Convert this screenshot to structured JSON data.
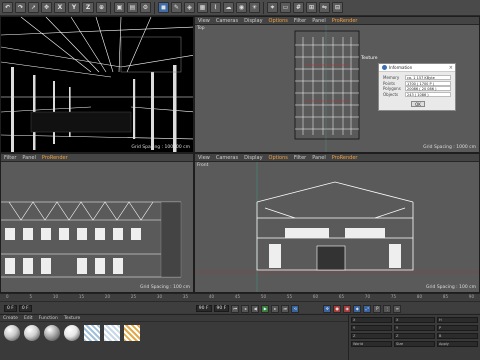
{
  "toolbar": {
    "axis_x": "X",
    "axis_y": "Y",
    "axis_z": "Z"
  },
  "viewport_menu": [
    "View",
    "Cameras",
    "Display",
    "Options",
    "Filter",
    "Panel",
    "ProRender"
  ],
  "perspective_menu": [
    "Filter",
    "Panel",
    "ProRender"
  ],
  "viewports": {
    "top": {
      "title": "Top",
      "grid": "Grid Spacing : 1000 cm"
    },
    "perspective": {
      "title": "",
      "grid": "Grid Spacing : 100000 cm"
    },
    "right": {
      "title": "",
      "grid": "Grid Spacing : 100 cm"
    },
    "front": {
      "title": "Front",
      "grid": "Grid Spacing : 100 cm"
    }
  },
  "texture_label": "Texture",
  "info_dialog": {
    "title": "Information",
    "rows": [
      {
        "key": "Memory",
        "value": "ca. 1 157 KByte"
      },
      {
        "key": "Points",
        "value": "1700 ( 1700 P )"
      },
      {
        "key": "Polygons",
        "value": "20086 ( 20 086 )"
      },
      {
        "key": "Objects",
        "value": "243 ( 1086 )"
      }
    ],
    "ok_label": "OK"
  },
  "timeline": {
    "ticks": [
      "0",
      "5",
      "10",
      "15",
      "20",
      "25",
      "30",
      "35",
      "40",
      "45",
      "50",
      "55",
      "60",
      "65",
      "70",
      "75",
      "80",
      "85",
      "90"
    ],
    "current_frame": "0 F",
    "start_frame": "0 F",
    "end_frame": "90 F",
    "frame_field": "90 F"
  },
  "materials": {
    "menu": [
      "Create",
      "Edit",
      "Function",
      "Texture"
    ],
    "items": [
      {
        "label": "",
        "kind": "ball",
        "color": "#c8c8c8"
      },
      {
        "label": "",
        "kind": "ball",
        "color": "#d0d0d0"
      },
      {
        "label": "",
        "kind": "ball",
        "color": "#a8a8a8"
      },
      {
        "label": "",
        "kind": "ball",
        "color": "#e6e6e6"
      },
      {
        "label": "",
        "kind": "tile",
        "color": "#9fc0d8"
      },
      {
        "label": "",
        "kind": "tile",
        "color": "#c7d9e8"
      },
      {
        "label": "",
        "kind": "tile",
        "color": "#e4a848",
        "selected": true
      }
    ]
  },
  "coordinates": {
    "rows": [
      [
        "X",
        "X",
        "H"
      ],
      [
        "Y",
        "Y",
        "P"
      ],
      [
        "Z",
        "Z",
        "B"
      ]
    ],
    "bottom": [
      "World",
      "Size",
      "Apply"
    ]
  }
}
